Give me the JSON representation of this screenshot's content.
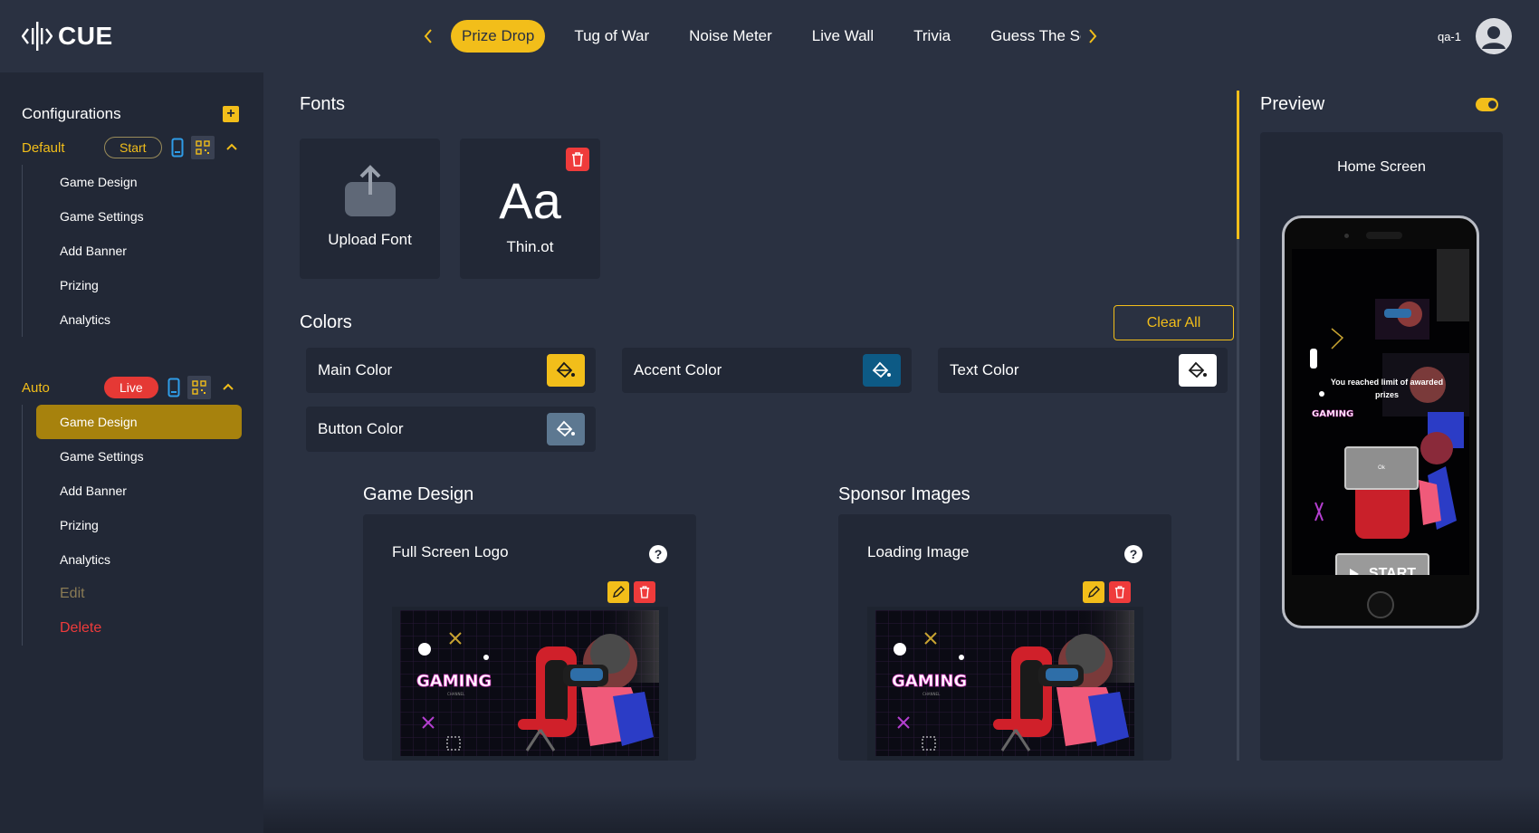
{
  "app": {
    "logo_text": "CUE",
    "user_name": "qa-1"
  },
  "tabs": [
    {
      "label": "Prize Drop",
      "active": true
    },
    {
      "label": "Tug of War"
    },
    {
      "label": "Noise Meter"
    },
    {
      "label": "Live Wall"
    },
    {
      "label": "Trivia"
    },
    {
      "label": "Guess The Sc"
    }
  ],
  "sidebar": {
    "title": "Configurations",
    "groups": [
      {
        "name": "Default",
        "status": "Start",
        "items": [
          "Game Design",
          "Game Settings",
          "Add Banner",
          "Prizing",
          "Analytics"
        ]
      },
      {
        "name": "Auto",
        "status": "Live",
        "items": [
          "Game Design",
          "Game Settings",
          "Add Banner",
          "Prizing",
          "Analytics"
        ],
        "active_item": "Game Design",
        "actions": [
          "Edit",
          "Delete"
        ]
      }
    ]
  },
  "fonts": {
    "title": "Fonts",
    "upload_label": "Upload Font",
    "font_sample": "Aa",
    "font_name": "Thin.ot"
  },
  "colors": {
    "title": "Colors",
    "clear_label": "Clear All",
    "items": [
      {
        "label": "Main Color",
        "value": "#f2be1a"
      },
      {
        "label": "Accent Color",
        "value": "#0d5a85"
      },
      {
        "label": "Text Color",
        "value": "#ffffff"
      },
      {
        "label": "Button Color",
        "value": "#5d7891"
      }
    ]
  },
  "game_design": {
    "title": "Game Design",
    "card_label": "Full Screen Logo",
    "help": "?"
  },
  "sponsor_images": {
    "title": "Sponsor Images",
    "card_label": "Loading Image",
    "help": "?"
  },
  "image_text": {
    "brand": "GAMING",
    "sub": "CHANNEL"
  },
  "preview": {
    "title": "Preview",
    "screen_name": "Home Screen",
    "message": "You reached limit of awarded prizes",
    "ok_label": "Ok",
    "start_label": "START"
  }
}
